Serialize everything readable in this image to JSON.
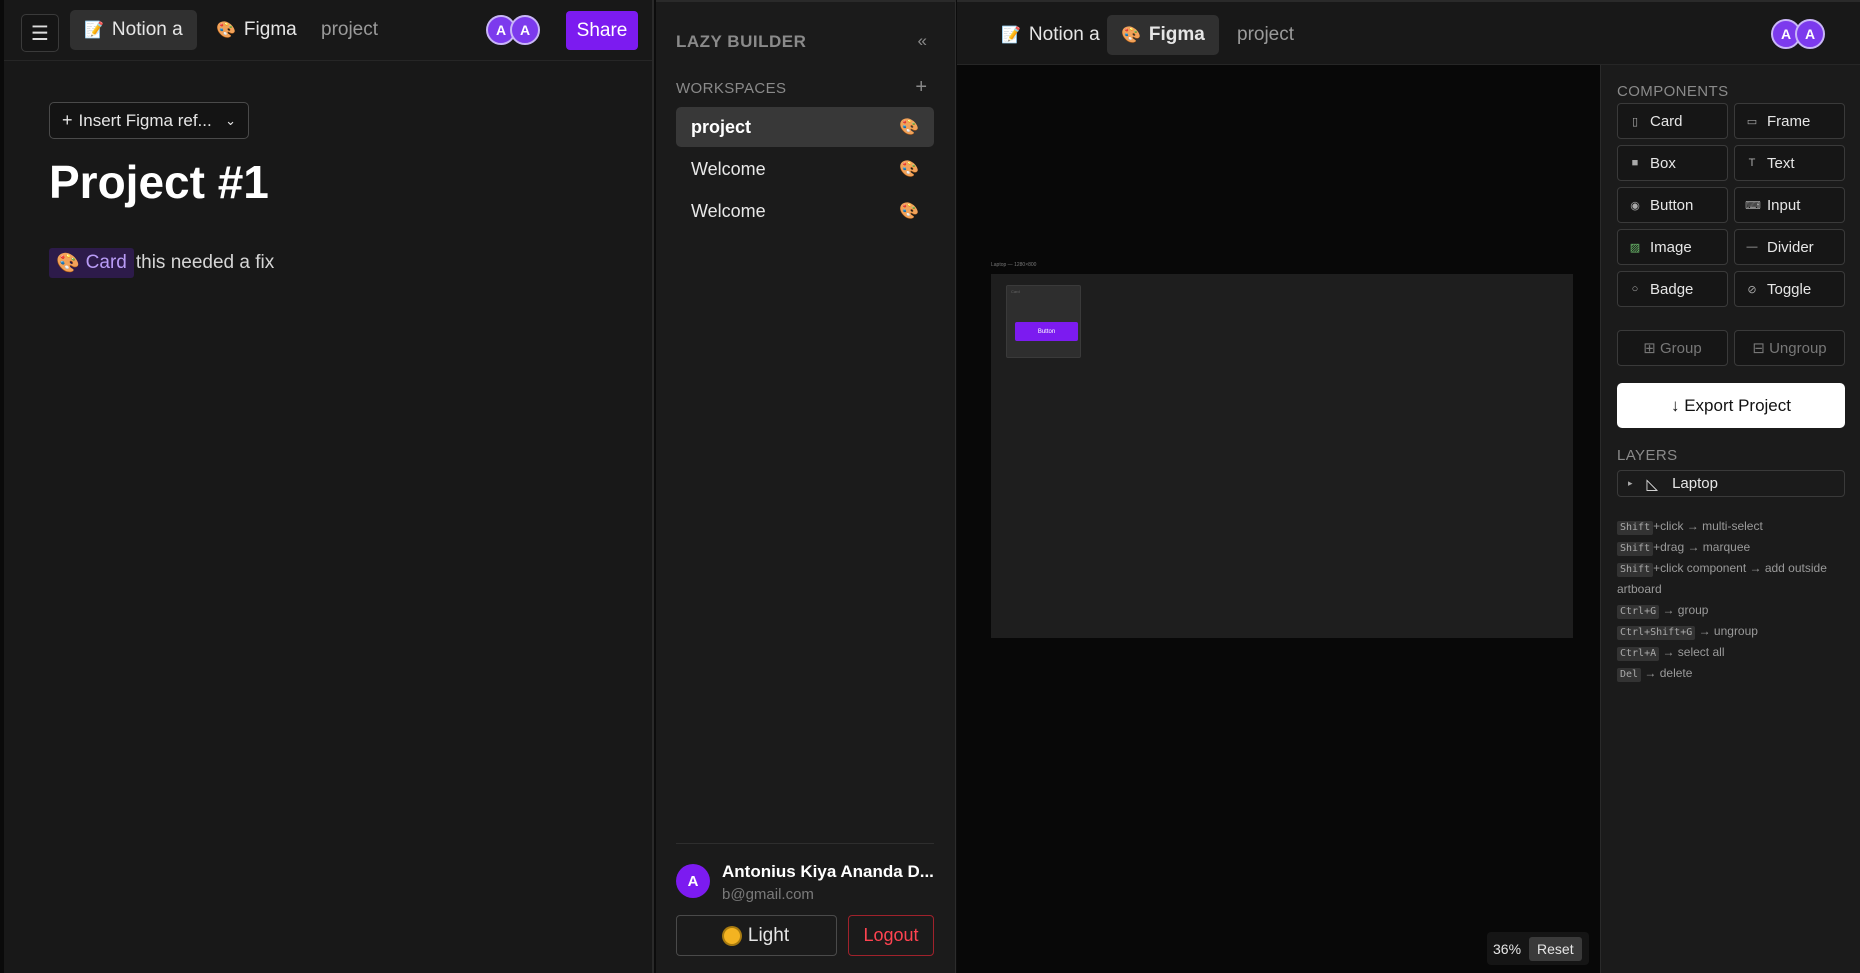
{
  "left_pane": {
    "menu_icon": "hamburger-icon",
    "tabs": [
      {
        "label": "Notion a",
        "icon": "notion-page-icon"
      },
      {
        "label": "Figma",
        "icon": "palette-icon"
      },
      {
        "label": "project"
      }
    ],
    "avatars": [
      "A",
      "A"
    ],
    "share_label": "Share",
    "insert_label": "Insert Figma ref...",
    "page_title": "Project #1",
    "chip_label": "Card",
    "body_text": "this needed a fix"
  },
  "sidebar": {
    "brand": "LAZY BUILDER",
    "collapse_glyph": "«",
    "workspaces_label": "WORKSPACES",
    "add_glyph": "+",
    "items": [
      {
        "label": "project",
        "icon": "palette-icon"
      },
      {
        "label": "Welcome",
        "icon": "palette-icon"
      },
      {
        "label": "Welcome",
        "icon": "palette-icon"
      }
    ],
    "user": {
      "initial": "A",
      "name": "Antonius Kiya Ananda D...",
      "email": "b@gmail.com"
    },
    "light_label": "Light",
    "logout_label": "Logout"
  },
  "editor": {
    "tabs": [
      {
        "label": "Notion a",
        "icon": "notion-page-icon"
      },
      {
        "label": "Figma",
        "icon": "palette-icon"
      },
      {
        "label": "project"
      }
    ],
    "avatars": [
      "A",
      "A"
    ],
    "canvas": {
      "artboard_label": "Laptop — 1280×800",
      "card_label": "Card",
      "button_label": "Button",
      "zoom": "36%",
      "reset_label": "Reset"
    },
    "components_label": "COMPONENTS",
    "components": [
      {
        "label": "Card",
        "glyph": "▯"
      },
      {
        "label": "Frame",
        "glyph": "▭"
      },
      {
        "label": "Box",
        "glyph": "■"
      },
      {
        "label": "Text",
        "glyph": "T"
      },
      {
        "label": "Button",
        "glyph": "◉"
      },
      {
        "label": "Input",
        "glyph": "⌨"
      },
      {
        "label": "Image",
        "glyph": "▨"
      },
      {
        "label": "Divider",
        "glyph": "—"
      },
      {
        "label": "Badge",
        "glyph": "○"
      },
      {
        "label": "Toggle",
        "glyph": "⊘"
      }
    ],
    "group_label": "⊞ Group",
    "ungroup_label": "⊟ Ungroup",
    "export_label": "↓ Export Project",
    "layers_label": "LAYERS",
    "layer_name": "Laptop",
    "hints": [
      {
        "key": "Shift",
        "text": "+click → multi-select"
      },
      {
        "key": "Shift",
        "text": "+drag → marquee"
      },
      {
        "key": "Shift",
        "text": "+click component → add outside artboard"
      },
      {
        "key": "Ctrl+G",
        "text": " → group"
      },
      {
        "key": "Ctrl+Shift+G",
        "text": " → ungroup"
      },
      {
        "key": "Ctrl+A",
        "text": " → select all"
      },
      {
        "key": "Del",
        "text": " → delete"
      }
    ]
  },
  "colors": {
    "accent": "#7c1bf0",
    "danger": "#ff4350",
    "background": "#181818"
  }
}
